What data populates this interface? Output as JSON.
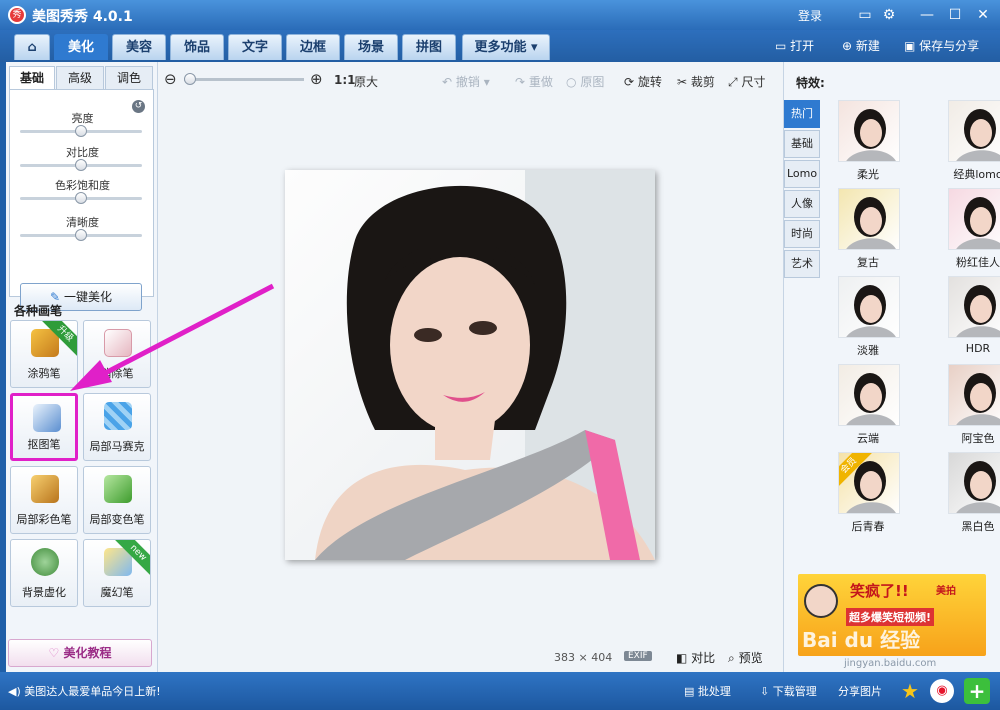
{
  "window": {
    "title": "美图秀秀 4.0.1",
    "logo_text": "秀",
    "login": "登录"
  },
  "tabs": [
    {
      "label": "美化",
      "active": true
    },
    {
      "label": "美容"
    },
    {
      "label": "饰品"
    },
    {
      "label": "文字"
    },
    {
      "label": "边框"
    },
    {
      "label": "场景"
    },
    {
      "label": "拼图"
    },
    {
      "label": "更多功能"
    }
  ],
  "file_actions": {
    "open": "打开",
    "new": "新建",
    "save_share": "保存与分享"
  },
  "left_panel": {
    "subtabs": [
      "基础",
      "高级",
      "调色"
    ],
    "sliders": [
      {
        "label": "亮度",
        "value": 0.5
      },
      {
        "label": "对比度",
        "value": 0.5
      },
      {
        "label": "色彩饱和度",
        "value": 0.5
      },
      {
        "label": "清晰度",
        "value": 0.5
      }
    ],
    "one_key": "一键美化",
    "brush_header": "各种画笔",
    "brushes": [
      {
        "label": "涂鸦笔",
        "badge": "升级"
      },
      {
        "label": "消除笔"
      },
      {
        "label": "抠图笔"
      },
      {
        "label": "局部马赛克"
      },
      {
        "label": "局部彩色笔"
      },
      {
        "label": "局部变色笔"
      },
      {
        "label": "背景虚化"
      },
      {
        "label": "魔幻笔",
        "badge": "new"
      }
    ],
    "tutorial": "美化教程"
  },
  "toolbar": {
    "ratio": "1:1",
    "original_size": "原大",
    "undo": "撤销",
    "redo": "重做",
    "original": "原图",
    "rotate": "旋转",
    "crop": "裁剪",
    "size": "尺寸"
  },
  "zoom": {
    "level": 0.0
  },
  "canvas_footer": {
    "width": "383",
    "times": "×",
    "height": "404",
    "exif": "EXIF",
    "compare": "对比",
    "preview": "预览"
  },
  "effects": {
    "header": "特效:",
    "tabs": [
      "热门",
      "基础",
      "Lomo",
      "人像",
      "时尚",
      "艺术"
    ],
    "items": [
      "柔光",
      "经典lomo",
      "复古",
      "粉红佳人",
      "淡雅",
      "HDR",
      "云端",
      "阿宝色",
      "后青春",
      "黑白色"
    ],
    "badge_text": "会员"
  },
  "ad": {
    "headline": "笑疯了!!",
    "subline": "超多爆笑短视频!",
    "brand": "美拍",
    "watermark": "Bai du 经验",
    "watermark_url": "jingyan.baidu.com"
  },
  "statusbar": {
    "message": "美图达人最爱单品今日上新!",
    "batch": "批处理",
    "download": "下载管理",
    "share_image": "分享图片"
  },
  "colors": {
    "accent": "#2f7ad0",
    "highlight": "#e020c8",
    "titlebar": "#2a6cb8"
  }
}
